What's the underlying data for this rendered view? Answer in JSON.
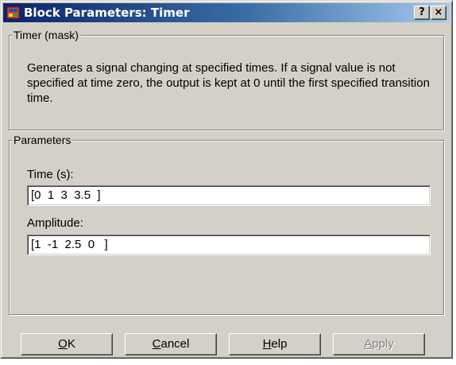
{
  "window": {
    "title": "Block Parameters: Timer",
    "help_glyph": "?",
    "close_glyph": "×",
    "icon": "simulink-block-icon"
  },
  "mask_group": {
    "label": "Timer (mask)",
    "description": "Generates a signal changing at specified times. If a signal value is not specified at time zero, the output is kept at 0 until the first specified transition time."
  },
  "parameters_group": {
    "label": "Parameters",
    "time_label": "Time (s):",
    "time_value": "[0  1  3  3.5  ]",
    "amplitude_label": "Amplitude:",
    "amplitude_value": "[1  -1  2.5  0   ]"
  },
  "buttons": {
    "ok": {
      "mnemonic": "O",
      "rest": "K"
    },
    "cancel": {
      "mnemonic": "C",
      "rest": "ancel"
    },
    "help": {
      "mnemonic": "H",
      "rest": "elp"
    },
    "apply": {
      "mnemonic": "A",
      "rest": "pply",
      "enabled": false
    }
  },
  "colors": {
    "titlebar_start": "#0a246a",
    "titlebar_end": "#a6caf0",
    "face": "#d4d0c8"
  }
}
